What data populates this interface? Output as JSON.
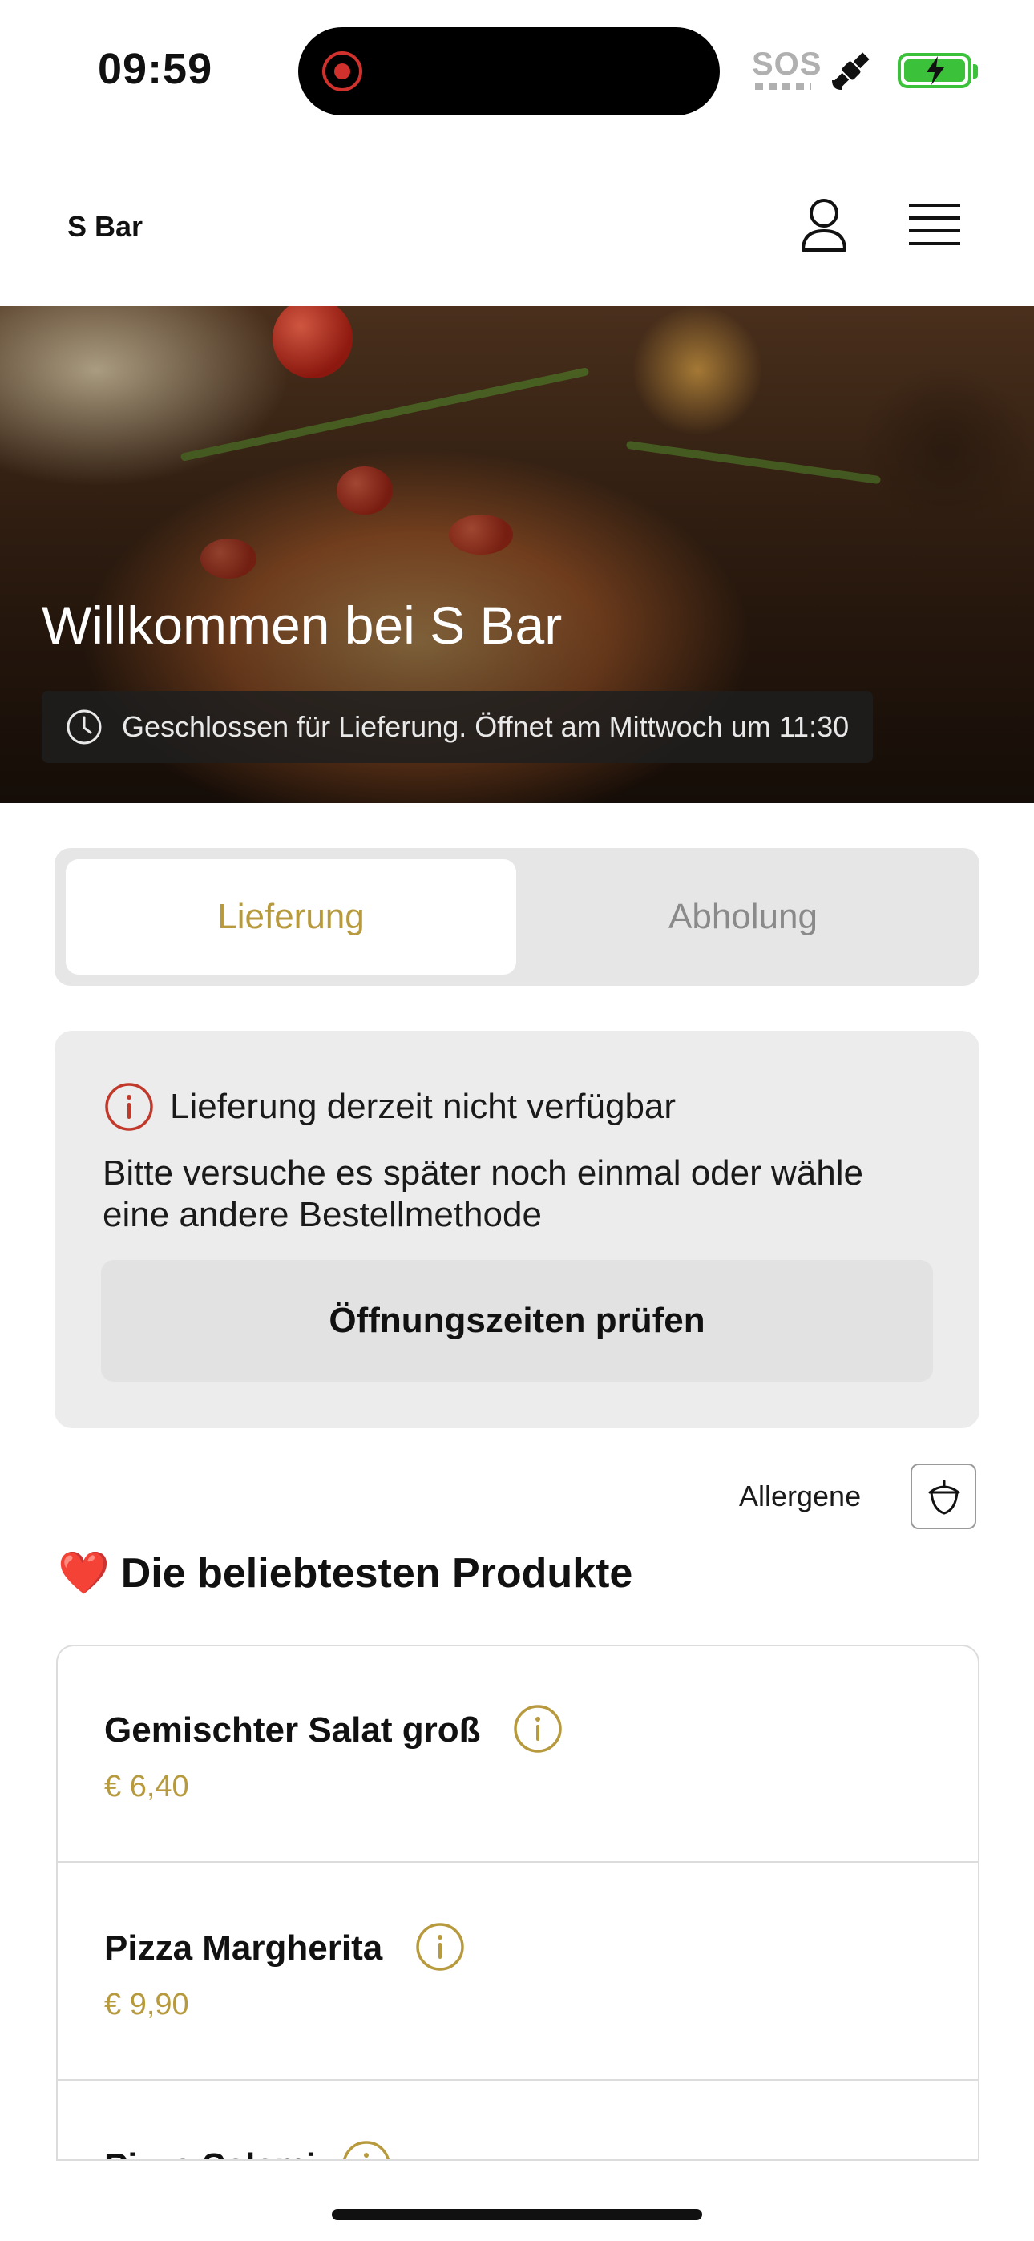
{
  "status_bar": {
    "time": "09:59",
    "sos_label": "SOS"
  },
  "header": {
    "brand": "S Bar"
  },
  "hero": {
    "title": "Willkommen bei S Bar",
    "status": "Geschlossen für Lieferung. Öffnet am Mittwoch um 11:30"
  },
  "order_mode": {
    "options": [
      "Lieferung",
      "Abholung"
    ],
    "selected": "Lieferung"
  },
  "notice": {
    "title": "Lieferung derzeit nicht verfügbar",
    "text": "Bitte versuche es später noch einmal oder wähle eine andere Bestellmethode",
    "button": "Öffnungszeiten prüfen"
  },
  "allergens": {
    "label": "Allergene"
  },
  "popular": {
    "heading": "Die beliebtesten Produkte",
    "emoji": "❤️",
    "items": [
      {
        "name": "Gemischter Salat groß",
        "price": "€ 6,40"
      },
      {
        "name": "Pizza Margherita",
        "price": "€ 9,90"
      },
      {
        "name": "Pizza Salami",
        "price": ""
      }
    ]
  },
  "colors": {
    "accent": "#b89a3e",
    "alert": "#c0392b",
    "battery": "#3cc13b"
  }
}
